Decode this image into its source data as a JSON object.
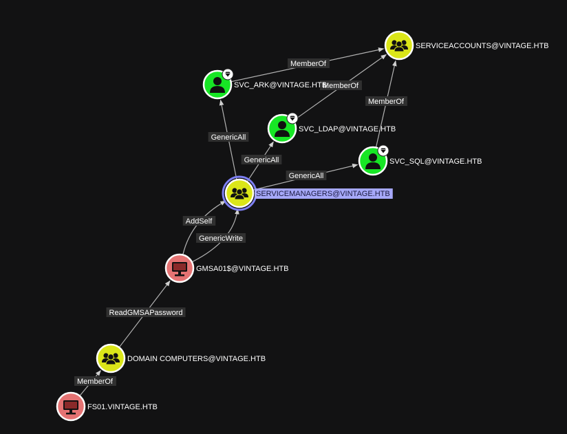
{
  "colors": {
    "background": "#121213",
    "group_node": "#dbe619",
    "user_node": "#17e625",
    "computer_node": "#e57373",
    "node_border": "#ffffff",
    "selected_ring": "#7d7ff3",
    "selected_label_bg": "#a6a8f9",
    "edge": "#b3b3b3",
    "edge_label_bg": "#303030"
  },
  "nodes": [
    {
      "id": "serviceaccounts",
      "label": "SERVICEACCOUNTS@VINTAGE.HTB",
      "kind": "group",
      "icon": "group-icon",
      "badge": false,
      "selected": false
    },
    {
      "id": "svc_ark",
      "label": "SVC_ARK@VINTAGE.HTB",
      "kind": "user",
      "icon": "user-icon",
      "badge": true,
      "selected": false
    },
    {
      "id": "svc_ldap",
      "label": "SVC_LDAP@VINTAGE.HTB",
      "kind": "user",
      "icon": "user-icon",
      "badge": true,
      "selected": false
    },
    {
      "id": "svc_sql",
      "label": "SVC_SQL@VINTAGE.HTB",
      "kind": "user",
      "icon": "user-icon",
      "badge": true,
      "selected": false
    },
    {
      "id": "servicemanagers",
      "label": "SERVICEMANAGERS@VINTAGE.HTB",
      "kind": "group",
      "icon": "group-icon",
      "badge": false,
      "selected": true
    },
    {
      "id": "gmsa01",
      "label": "GMSA01$@VINTAGE.HTB",
      "kind": "computer",
      "icon": "computer-icon",
      "badge": false,
      "selected": false
    },
    {
      "id": "domain_computers",
      "label": "DOMAIN COMPUTERS@VINTAGE.HTB",
      "kind": "group",
      "icon": "group-icon",
      "badge": false,
      "selected": false
    },
    {
      "id": "fs01",
      "label": "FS01.VINTAGE.HTB",
      "kind": "computer",
      "icon": "computer-icon",
      "badge": false,
      "selected": false
    }
  ],
  "edges": [
    {
      "id": "e1",
      "source": "svc_ark",
      "target": "serviceaccounts",
      "label": "MemberOf"
    },
    {
      "id": "e2",
      "source": "svc_ldap",
      "target": "serviceaccounts",
      "label": "MemberOf"
    },
    {
      "id": "e3",
      "source": "svc_sql",
      "target": "serviceaccounts",
      "label": "MemberOf"
    },
    {
      "id": "e4",
      "source": "servicemanagers",
      "target": "svc_ark",
      "label": "GenericAll"
    },
    {
      "id": "e5",
      "source": "servicemanagers",
      "target": "svc_ldap",
      "label": "GenericAll"
    },
    {
      "id": "e6",
      "source": "servicemanagers",
      "target": "svc_sql",
      "label": "GenericAll"
    },
    {
      "id": "e7",
      "source": "gmsa01",
      "target": "servicemanagers",
      "label": "AddSelf"
    },
    {
      "id": "e8",
      "source": "gmsa01",
      "target": "servicemanagers",
      "label": "GenericWrite"
    },
    {
      "id": "e9",
      "source": "domain_computers",
      "target": "gmsa01",
      "label": "ReadGMSAPassword"
    },
    {
      "id": "e10",
      "source": "fs01",
      "target": "domain_computers",
      "label": "MemberOf"
    }
  ]
}
